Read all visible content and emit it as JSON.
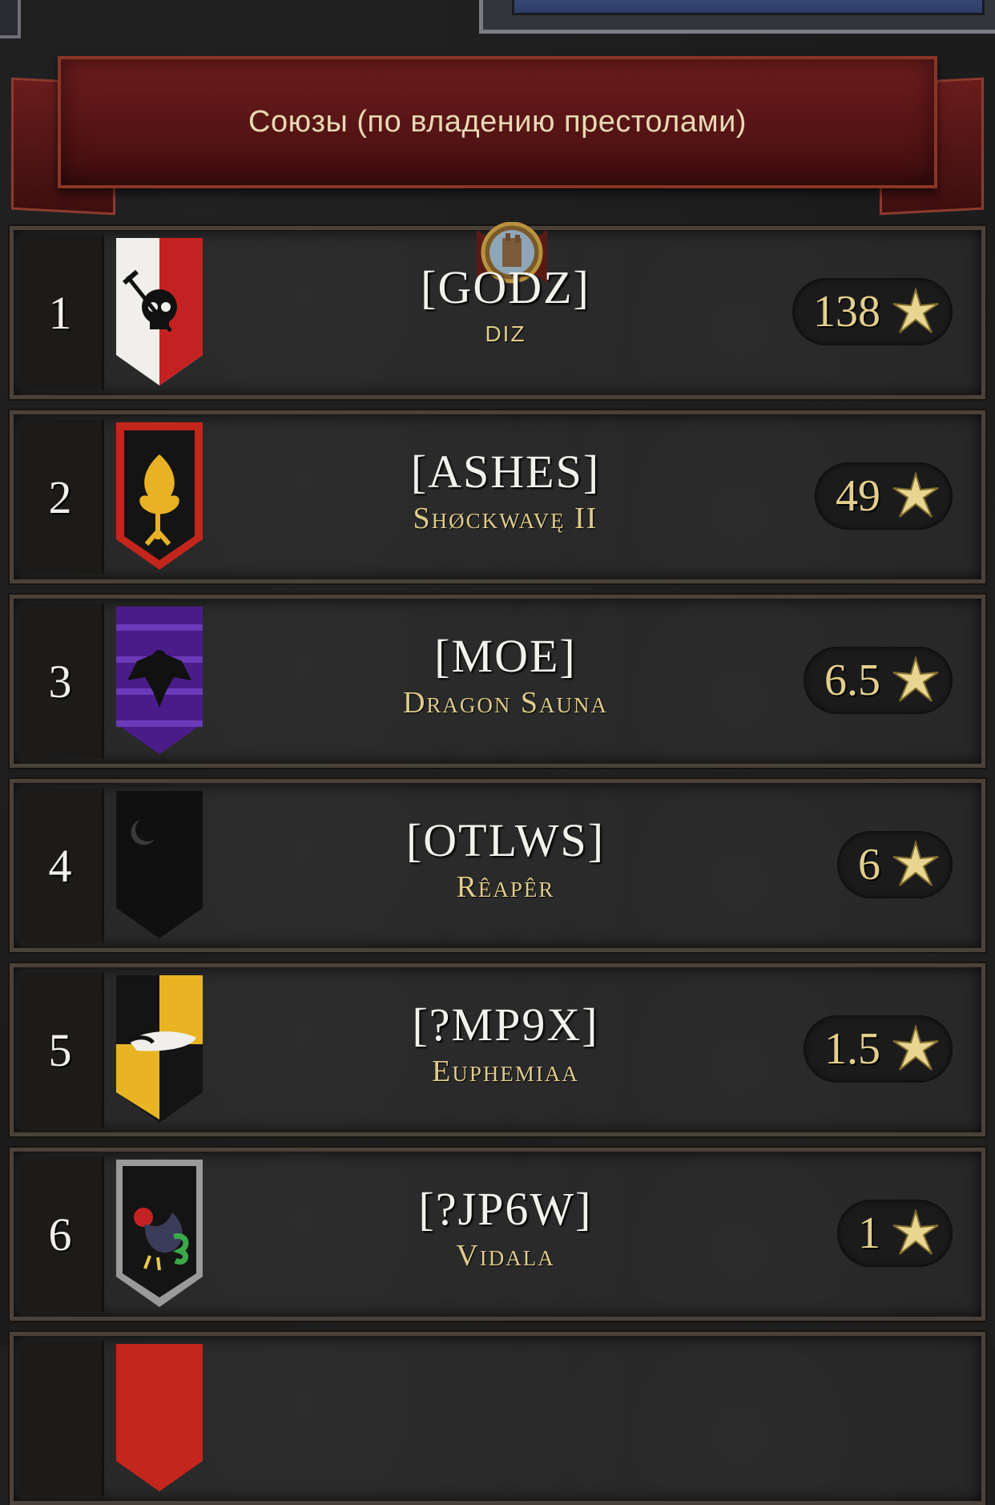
{
  "header": {
    "title": "Союзы (по владению престолами)"
  },
  "alliances": [
    {
      "rank": "1",
      "tag": "[GODZ]",
      "leader": "DIZ",
      "score": "138",
      "banner": "skull-banner"
    },
    {
      "rank": "2",
      "tag": "[ASHES]",
      "leader": "Shøckwavę II",
      "score": "49",
      "banner": "flaming-tree-banner"
    },
    {
      "rank": "3",
      "tag": "[MOE]",
      "leader": "Dragon Sauna",
      "score": "6.5",
      "banner": "eagle-banner"
    },
    {
      "rank": "4",
      "tag": "[OTLWS]",
      "leader": "Rêapêr",
      "score": "6",
      "banner": "crescent-moon-banner"
    },
    {
      "rank": "5",
      "tag": "[?MP9X]",
      "leader": "Euphemiaa",
      "score": "1.5",
      "banner": "badger-banner"
    },
    {
      "rank": "6",
      "tag": "[?JP6W]",
      "leader": "Vidala",
      "score": "1",
      "banner": "griffin-banner"
    }
  ],
  "icons": {
    "score": "star-icon",
    "throne": "throne-crest-icon"
  },
  "colors": {
    "ribbon": "#6e1d1d",
    "gold_text": "#e0cc8a",
    "star": "#e8d58f"
  }
}
